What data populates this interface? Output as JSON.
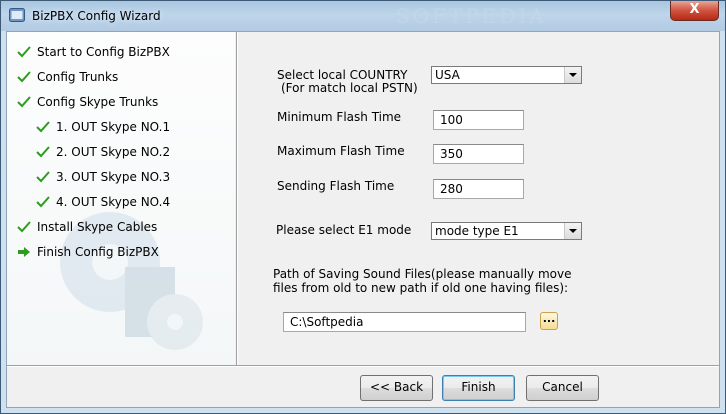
{
  "window": {
    "title": "BizPBX Config Wizard",
    "watermark": "SOFTPEDIA",
    "close_label": "X",
    "icon": "app-icon"
  },
  "steps": [
    {
      "label": "Start to Config BizPBX",
      "icon": "checkmark-icon",
      "status": "done"
    },
    {
      "label": "Config Trunks",
      "icon": "checkmark-icon",
      "status": "done"
    },
    {
      "label": "Config Skype Trunks",
      "icon": "checkmark-icon",
      "status": "done"
    },
    {
      "label": "1. OUT Skype NO.1",
      "icon": "checkmark-icon",
      "status": "done"
    },
    {
      "label": "2. OUT Skype NO.2",
      "icon": "checkmark-icon",
      "status": "done"
    },
    {
      "label": "3. OUT Skype NO.3",
      "icon": "checkmark-icon",
      "status": "done"
    },
    {
      "label": "4. OUT Skype NO.4",
      "icon": "checkmark-icon",
      "status": "done"
    },
    {
      "label": "Install Skype Cables",
      "icon": "checkmark-icon",
      "status": "done"
    },
    {
      "label": "Finish Config BizPBX",
      "icon": "arrow-right-icon",
      "status": "current"
    }
  ],
  "form": {
    "country_label_line1": "Select local COUNTRY",
    "country_label_line2": "(For match local PSTN)",
    "country_value": "USA",
    "min_flash_label": "Minimum Flash Time",
    "min_flash_value": "100",
    "max_flash_label": "Maximum Flash Time",
    "max_flash_value": "350",
    "sending_flash_label": "Sending Flash Time",
    "sending_flash_value": "280",
    "e1_label": "Please select E1 mode",
    "e1_value": "mode type E1",
    "path_label_line1": "Path of Saving Sound Files(please manually move",
    "path_label_line2": "files from old to new path if old one having files):",
    "path_value": "C:\\Softpedia",
    "browse_label": "..."
  },
  "buttons": {
    "back": "<< Back",
    "finish": "Finish",
    "cancel": "Cancel"
  },
  "colors": {
    "check": "#2e9c1f",
    "arrow": "#2e9c1f",
    "close": "#c7432b"
  }
}
